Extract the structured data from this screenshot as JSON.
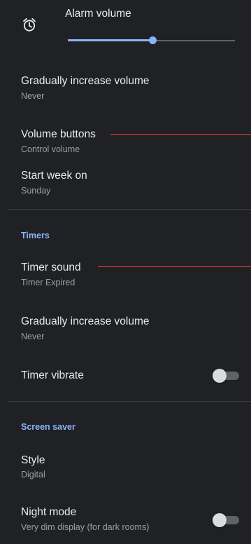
{
  "alarm_volume": {
    "icon": "alarm-clock-icon",
    "label": "Alarm volume",
    "level": 0.51
  },
  "alarm_settings": {
    "gradual_increase": {
      "title": "Gradually increase volume",
      "value": "Never"
    },
    "volume_buttons": {
      "title": "Volume buttons",
      "value": "Control volume"
    },
    "start_week": {
      "title": "Start week on",
      "value": "Sunday"
    }
  },
  "timers": {
    "header": "Timers",
    "timer_sound": {
      "title": "Timer sound",
      "value": "Timer Expired"
    },
    "gradual_increase": {
      "title": "Gradually increase volume",
      "value": "Never"
    },
    "timer_vibrate": {
      "title": "Timer vibrate",
      "on": false
    }
  },
  "screen_saver": {
    "header": "Screen saver",
    "style": {
      "title": "Style",
      "value": "Digital"
    },
    "night_mode": {
      "title": "Night mode",
      "value": "Very dim display (for dark rooms)",
      "on": false
    }
  },
  "colors": {
    "background": "#202124",
    "accent": "#8ab4f8",
    "annotation": "#e53935"
  }
}
